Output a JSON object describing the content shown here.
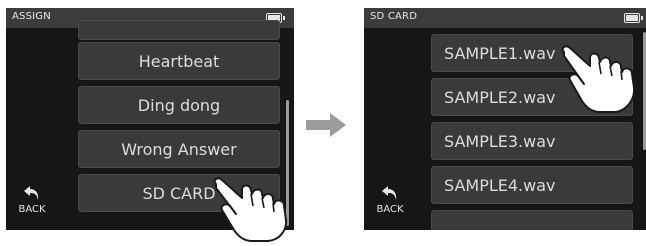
{
  "left_screen": {
    "title": "ASSIGN",
    "items": [
      {
        "label": ""
      },
      {
        "label": "Heartbeat"
      },
      {
        "label": "Ding dong"
      },
      {
        "label": "Wrong Answer"
      },
      {
        "label": "SD CARD"
      }
    ],
    "back_label": "BACK"
  },
  "right_screen": {
    "title": "SD CARD",
    "items": [
      {
        "label": "SAMPLE1.wav"
      },
      {
        "label": "SAMPLE2.wav"
      },
      {
        "label": "SAMPLE3.wav"
      },
      {
        "label": "SAMPLE4.wav"
      }
    ],
    "back_label": "BACK"
  },
  "icons": {
    "battery": "battery-icon",
    "back": "back-arrow-icon",
    "next": "right-arrow-icon",
    "touch": "pointing-hand-icon"
  },
  "colors": {
    "screen_bg": "#161616",
    "titlebar_bg": "#3c3c3c",
    "item_bg": "#3a3a3a",
    "arrow": "#9b9b9b"
  }
}
